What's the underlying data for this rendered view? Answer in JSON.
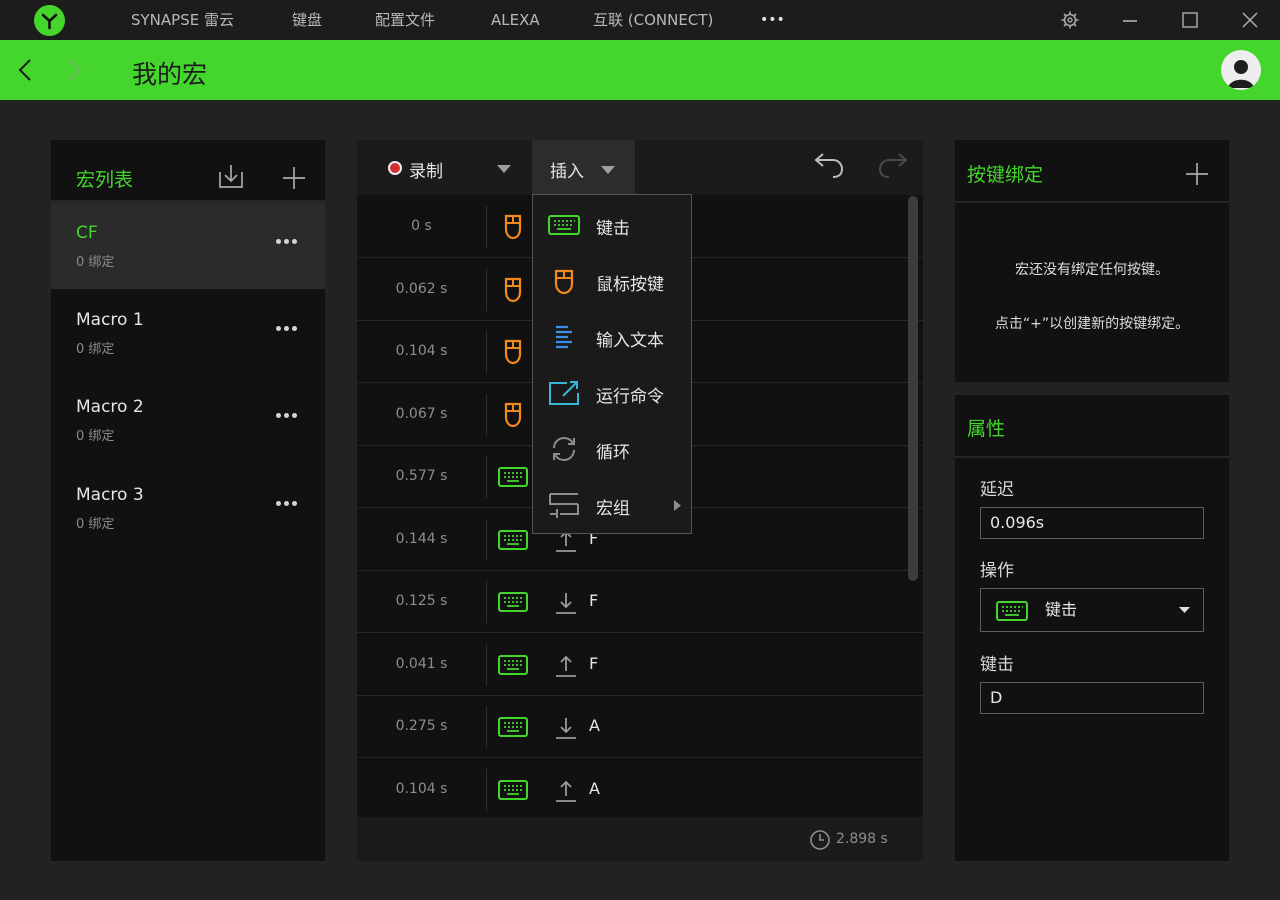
{
  "topbar": {
    "nav": [
      "SYNAPSE 雷云",
      "键盘",
      "配置文件",
      "ALEXA",
      "互联 (CONNECT)"
    ],
    "more": "•••"
  },
  "header": {
    "title": "我的宏"
  },
  "macro_list": {
    "title": "宏列表",
    "items": [
      {
        "name": "CF",
        "bindings": "0 绑定",
        "selected": true
      },
      {
        "name": "Macro 1",
        "bindings": "0 绑定",
        "selected": false
      },
      {
        "name": "Macro 2",
        "bindings": "0 绑定",
        "selected": false
      },
      {
        "name": "Macro 3",
        "bindings": "0 绑定",
        "selected": false
      }
    ]
  },
  "editor": {
    "record_label": "录制",
    "insert_label": "插入",
    "rows": [
      {
        "time": "0 s",
        "type": "mouse",
        "direction": "",
        "key": ""
      },
      {
        "time": "0.062 s",
        "type": "mouse",
        "direction": "",
        "key": ""
      },
      {
        "time": "0.104 s",
        "type": "mouse",
        "direction": "",
        "key": ""
      },
      {
        "time": "0.067 s",
        "type": "mouse",
        "direction": "",
        "key": ""
      },
      {
        "time": "0.577 s",
        "type": "keyboard",
        "direction": "",
        "key": ""
      },
      {
        "time": "0.144 s",
        "type": "keyboard",
        "direction": "up",
        "key": "F"
      },
      {
        "time": "0.125 s",
        "type": "keyboard",
        "direction": "down",
        "key": "F"
      },
      {
        "time": "0.041 s",
        "type": "keyboard",
        "direction": "up",
        "key": "F"
      },
      {
        "time": "0.275 s",
        "type": "keyboard",
        "direction": "down",
        "key": "A"
      },
      {
        "time": "0.104 s",
        "type": "keyboard",
        "direction": "up",
        "key": "A"
      }
    ],
    "total_time": "2.898 s"
  },
  "insert_menu": {
    "items": [
      {
        "label": "键击",
        "icon": "keyboard-icon"
      },
      {
        "label": "鼠标按键",
        "icon": "mouse-icon"
      },
      {
        "label": "输入文本",
        "icon": "text-icon"
      },
      {
        "label": "运行命令",
        "icon": "run-command-icon"
      },
      {
        "label": "循环",
        "icon": "loop-icon"
      },
      {
        "label": "宏组",
        "icon": "macro-group-icon"
      }
    ]
  },
  "key_binding": {
    "title": "按键绑定",
    "empty_msg": "宏还没有绑定任何按键。",
    "hint": "点击“+”以创建新的按键绑定。"
  },
  "properties": {
    "title": "属性",
    "delay_label": "延迟",
    "delay_value": "0.096s",
    "action_label": "操作",
    "action_value": "键击",
    "key_label": "键击",
    "key_value": "D"
  },
  "colors": {
    "accent": "#44d62c",
    "mouse_orange": "#f08a1c",
    "text_blue": "#3d8fe6",
    "command_cyan": "#38b6d6",
    "record_red": "#d32f2f"
  }
}
